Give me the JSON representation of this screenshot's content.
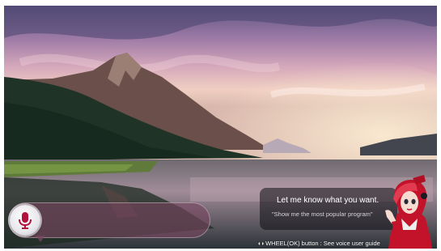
{
  "voice_input": {
    "mic_icon": "microphone-icon",
    "current_text": ""
  },
  "assistant": {
    "prompt": "Let me know what you want.",
    "example": "\"Show me the most popular program\"",
    "avatar_icon": "assistant-avatar-icon"
  },
  "guide": {
    "icon": "◖◗",
    "text": "WHEEL(OK) button : See voice user guide"
  },
  "colors": {
    "voice_bar": "#7a465f",
    "mic_button": "#e8e8ec",
    "accent_red": "#c2132b"
  }
}
